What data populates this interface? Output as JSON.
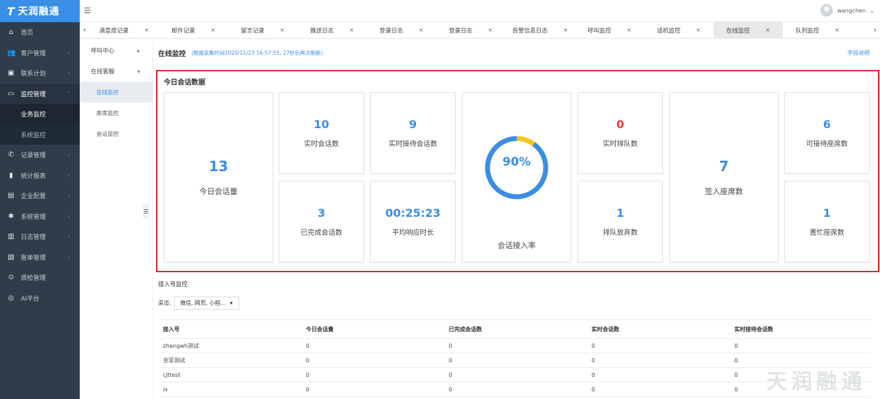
{
  "app": {
    "logo_text": "天润融通"
  },
  "sidebar": {
    "items": [
      {
        "label": "首页",
        "icon": "home-icon"
      },
      {
        "label": "客户管理",
        "icon": "users-icon",
        "arrow": "›"
      },
      {
        "label": "联系计划",
        "icon": "calendar-icon",
        "arrow": "›"
      },
      {
        "label": "监控管理",
        "icon": "monitor-icon",
        "arrow": "˅"
      },
      {
        "label": "记录管理",
        "icon": "phone-icon",
        "arrow": "›"
      },
      {
        "label": "统计报表",
        "icon": "bar-chart-icon",
        "arrow": "›"
      },
      {
        "label": "企业配置",
        "icon": "building-icon",
        "arrow": "›"
      },
      {
        "label": "系统管理",
        "icon": "gear-icon",
        "arrow": "›"
      },
      {
        "label": "日志管理",
        "icon": "notebook-icon",
        "arrow": "›"
      },
      {
        "label": "账单管理",
        "icon": "clipboard-icon",
        "arrow": "›"
      },
      {
        "label": "质检管理",
        "icon": "magnifier-icon"
      },
      {
        "label": "AI平台",
        "icon": "ai-icon"
      }
    ],
    "sub": [
      "业务监控",
      "系统监控"
    ]
  },
  "topbar": {
    "username": "wangchen",
    "dropdown": "⌄"
  },
  "tabs": [
    "满意度记录",
    "邮件记录",
    "留言记录",
    "推送日志",
    "登录日志",
    "登录日志",
    "告警信息日志",
    "呼叫监控",
    "话机监控",
    "在线监控",
    "队列监控"
  ],
  "tab_active": 9,
  "submenu": {
    "call_center": "呼叫中心",
    "online_service": "在线客服",
    "items": [
      "在线监控",
      "座席监控",
      "会话监控"
    ]
  },
  "page": {
    "title": "在线监控",
    "meta": "(数据采集时间2020/11/23 16:57:55, 27秒后再次刷新)",
    "field_help": "字段说明"
  },
  "stats": {
    "title": "今日会话数据",
    "today_sessions": {
      "value": "13",
      "label": "今日会话量"
    },
    "realtime_sessions": {
      "value": "10",
      "label": "实时会话数"
    },
    "realtime_accept": {
      "value": "9",
      "label": "实时接待会话数"
    },
    "completed": {
      "value": "3",
      "label": "已完成会话数"
    },
    "avg_response": {
      "value": "00:25:23",
      "label": "平均响应时长"
    },
    "accept_rate": {
      "value": "90%",
      "label": "会话接入率",
      "fraction": 0.9
    },
    "queue": {
      "value": "0",
      "label": "实时排队数"
    },
    "queue_abandon": {
      "value": "1",
      "label": "排队放弃数"
    },
    "signed_in": {
      "value": "7",
      "label": "签入座席数"
    },
    "available": {
      "value": "6",
      "label": "可接待座席数"
    },
    "busy": {
      "value": "1",
      "label": "置忙座席数"
    }
  },
  "colors": {
    "accent": "#3a8ee6",
    "ring_rest": "#f5c518",
    "alert": "#e53935",
    "box_border": "#d9262c"
  },
  "access": {
    "title": "接入号监控",
    "channel_label": "渠道:",
    "channel_value": "微信, 网页, 小程...",
    "columns": [
      "接入号",
      "今日会话量",
      "已完成会话数",
      "实时会话数",
      "实时接待会话数"
    ],
    "rows": [
      [
        "zhangwh测试",
        "0",
        "0",
        "0",
        "0"
      ],
      [
        "余菲测试",
        "0",
        "0",
        "0",
        "0"
      ],
      [
        "cjttest",
        "0",
        "0",
        "0",
        "0"
      ],
      [
        "lx",
        "0",
        "0",
        "0",
        "0"
      ]
    ]
  },
  "watermark": "天润融通"
}
